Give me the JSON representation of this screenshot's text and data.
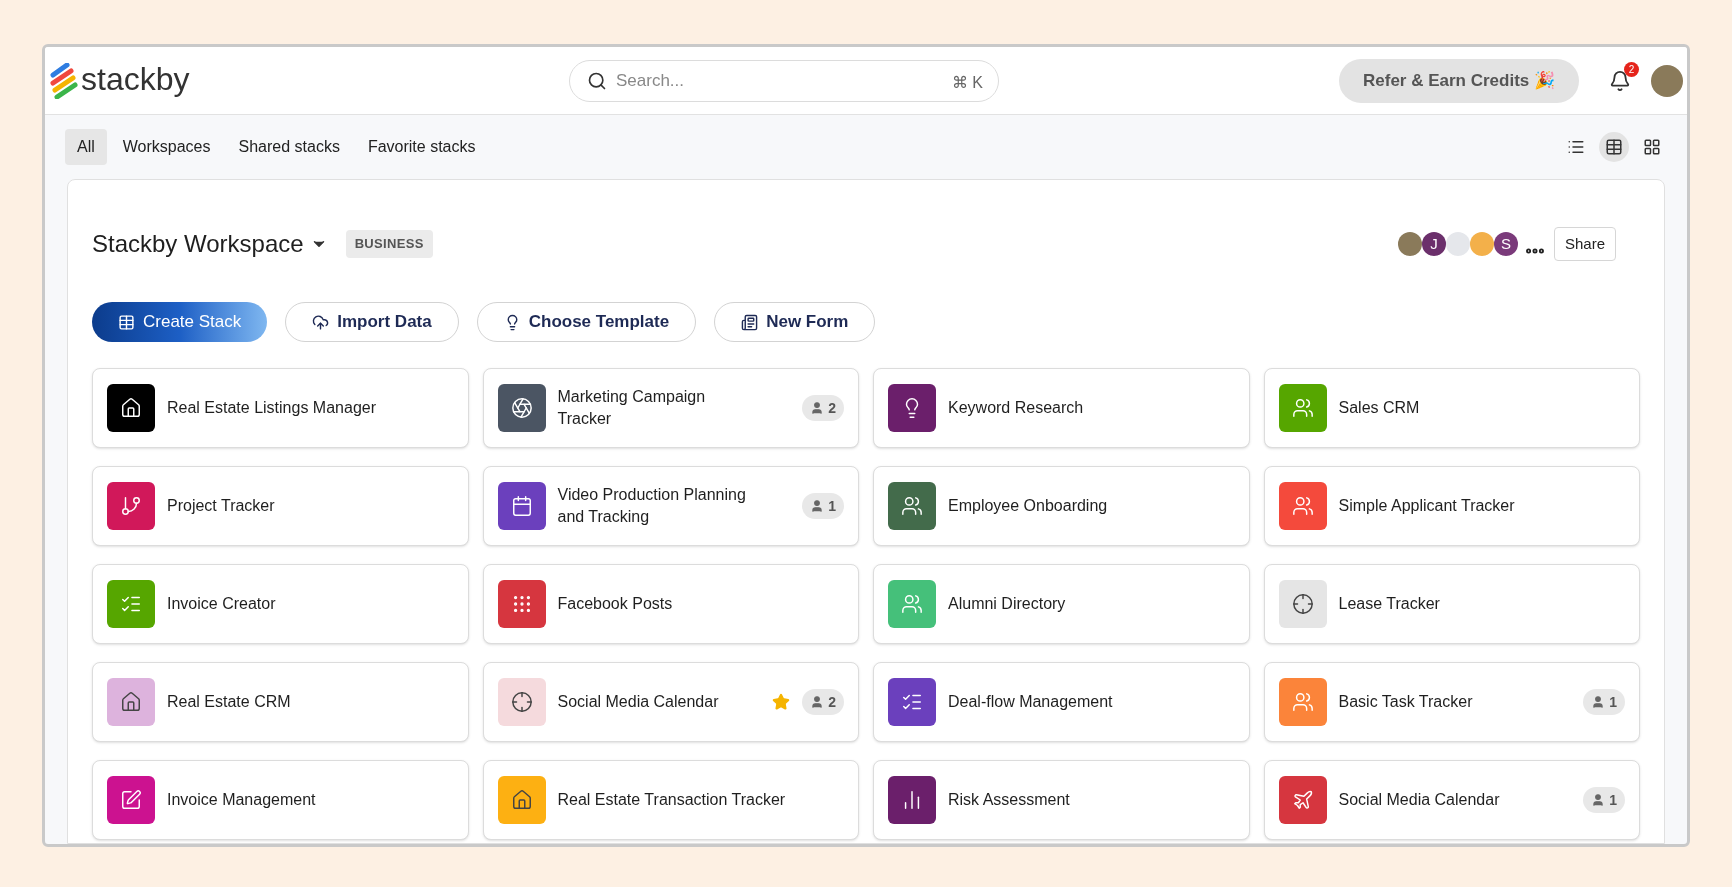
{
  "brand": {
    "name": "stackby"
  },
  "search": {
    "placeholder": "Search...",
    "shortcut": "⌘ K"
  },
  "refer_button": {
    "label": "Refer & Earn Credits 🎉"
  },
  "notifications": {
    "count": "2"
  },
  "filter_tabs": [
    {
      "label": "All",
      "selected": true
    },
    {
      "label": "Workspaces",
      "selected": false
    },
    {
      "label": "Shared stacks",
      "selected": false
    },
    {
      "label": "Favorite stacks",
      "selected": false
    }
  ],
  "view_modes": [
    {
      "kind": "list",
      "selected": false
    },
    {
      "kind": "table",
      "selected": true
    },
    {
      "kind": "grid",
      "selected": false
    }
  ],
  "workspace": {
    "title": "Stackby Workspace",
    "plan": "BUSINESS",
    "members": [
      {
        "color": "#8a7a5a"
      },
      {
        "initial": "J",
        "color": "#6b2f6b"
      },
      {
        "color": "#e5e7eb"
      },
      {
        "color": "#f3b04a"
      },
      {
        "initial": "S",
        "color": "#7a3a7a"
      }
    ],
    "share_button": "Share",
    "actions": [
      {
        "kind": "create",
        "label": "Create Stack",
        "primary": true
      },
      {
        "kind": "import",
        "label": "Import Data",
        "primary": false
      },
      {
        "kind": "template",
        "label": "Choose Template",
        "primary": false
      },
      {
        "kind": "form",
        "label": "New Form",
        "primary": false
      }
    ],
    "stacks": [
      {
        "name": "Real Estate Listings Manager",
        "kind": "house",
        "color": "#000000",
        "starred": false
      },
      {
        "name": "Marketing Campaign Tracker",
        "kind": "aperture",
        "color": "#4b5563",
        "starred": false,
        "shared": "2"
      },
      {
        "name": "Keyword Research",
        "kind": "bulb",
        "color": "#6b1f6b",
        "starred": false
      },
      {
        "name": "Sales CRM",
        "kind": "people",
        "color": "#56a600",
        "starred": false
      },
      {
        "name": "Project Tracker",
        "kind": "branch",
        "color": "#d1185a",
        "starred": false
      },
      {
        "name": "Video Production Planning and Tracking",
        "kind": "calendar",
        "color": "#6b40bd",
        "starred": false,
        "shared": "1"
      },
      {
        "name": "Employee Onboarding",
        "kind": "people",
        "color": "#436b4b",
        "starred": false
      },
      {
        "name": "Simple Applicant Tracker",
        "kind": "people",
        "color": "#f44a3c",
        "starred": false
      },
      {
        "name": "Invoice Creator",
        "kind": "list",
        "color": "#56a600",
        "starred": false
      },
      {
        "name": "Facebook Posts",
        "kind": "dots",
        "color": "#d6363f",
        "starred": false
      },
      {
        "name": "Alumni Directory",
        "kind": "people",
        "color": "#45c07a",
        "starred": false
      },
      {
        "name": "Lease Tracker",
        "kind": "target",
        "color": "#e5e5e5",
        "starred": false
      },
      {
        "name": "Real Estate CRM",
        "kind": "house",
        "color": "#ddb3dd",
        "starred": false
      },
      {
        "name": "Social Media Calendar",
        "kind": "target",
        "color": "#f5dadd",
        "starred": true,
        "shared": "2"
      },
      {
        "name": "Deal-flow Management",
        "kind": "list",
        "color": "#6b40bd",
        "starred": false
      },
      {
        "name": "Basic Task Tracker",
        "kind": "people",
        "color": "#fb843a",
        "starred": false,
        "shared": "1"
      },
      {
        "name": "Invoice Management",
        "kind": "edit",
        "color": "#cc1290",
        "starred": false
      },
      {
        "name": "Real Estate Transaction Tracker",
        "kind": "house",
        "color": "#fdb012",
        "starred": false
      },
      {
        "name": "Risk Assessment",
        "kind": "chart",
        "color": "#6b1f6b",
        "starred": false
      },
      {
        "name": "Social Media Calendar",
        "kind": "plane",
        "color": "#d6363f",
        "starred": false,
        "shared": "1"
      }
    ]
  }
}
